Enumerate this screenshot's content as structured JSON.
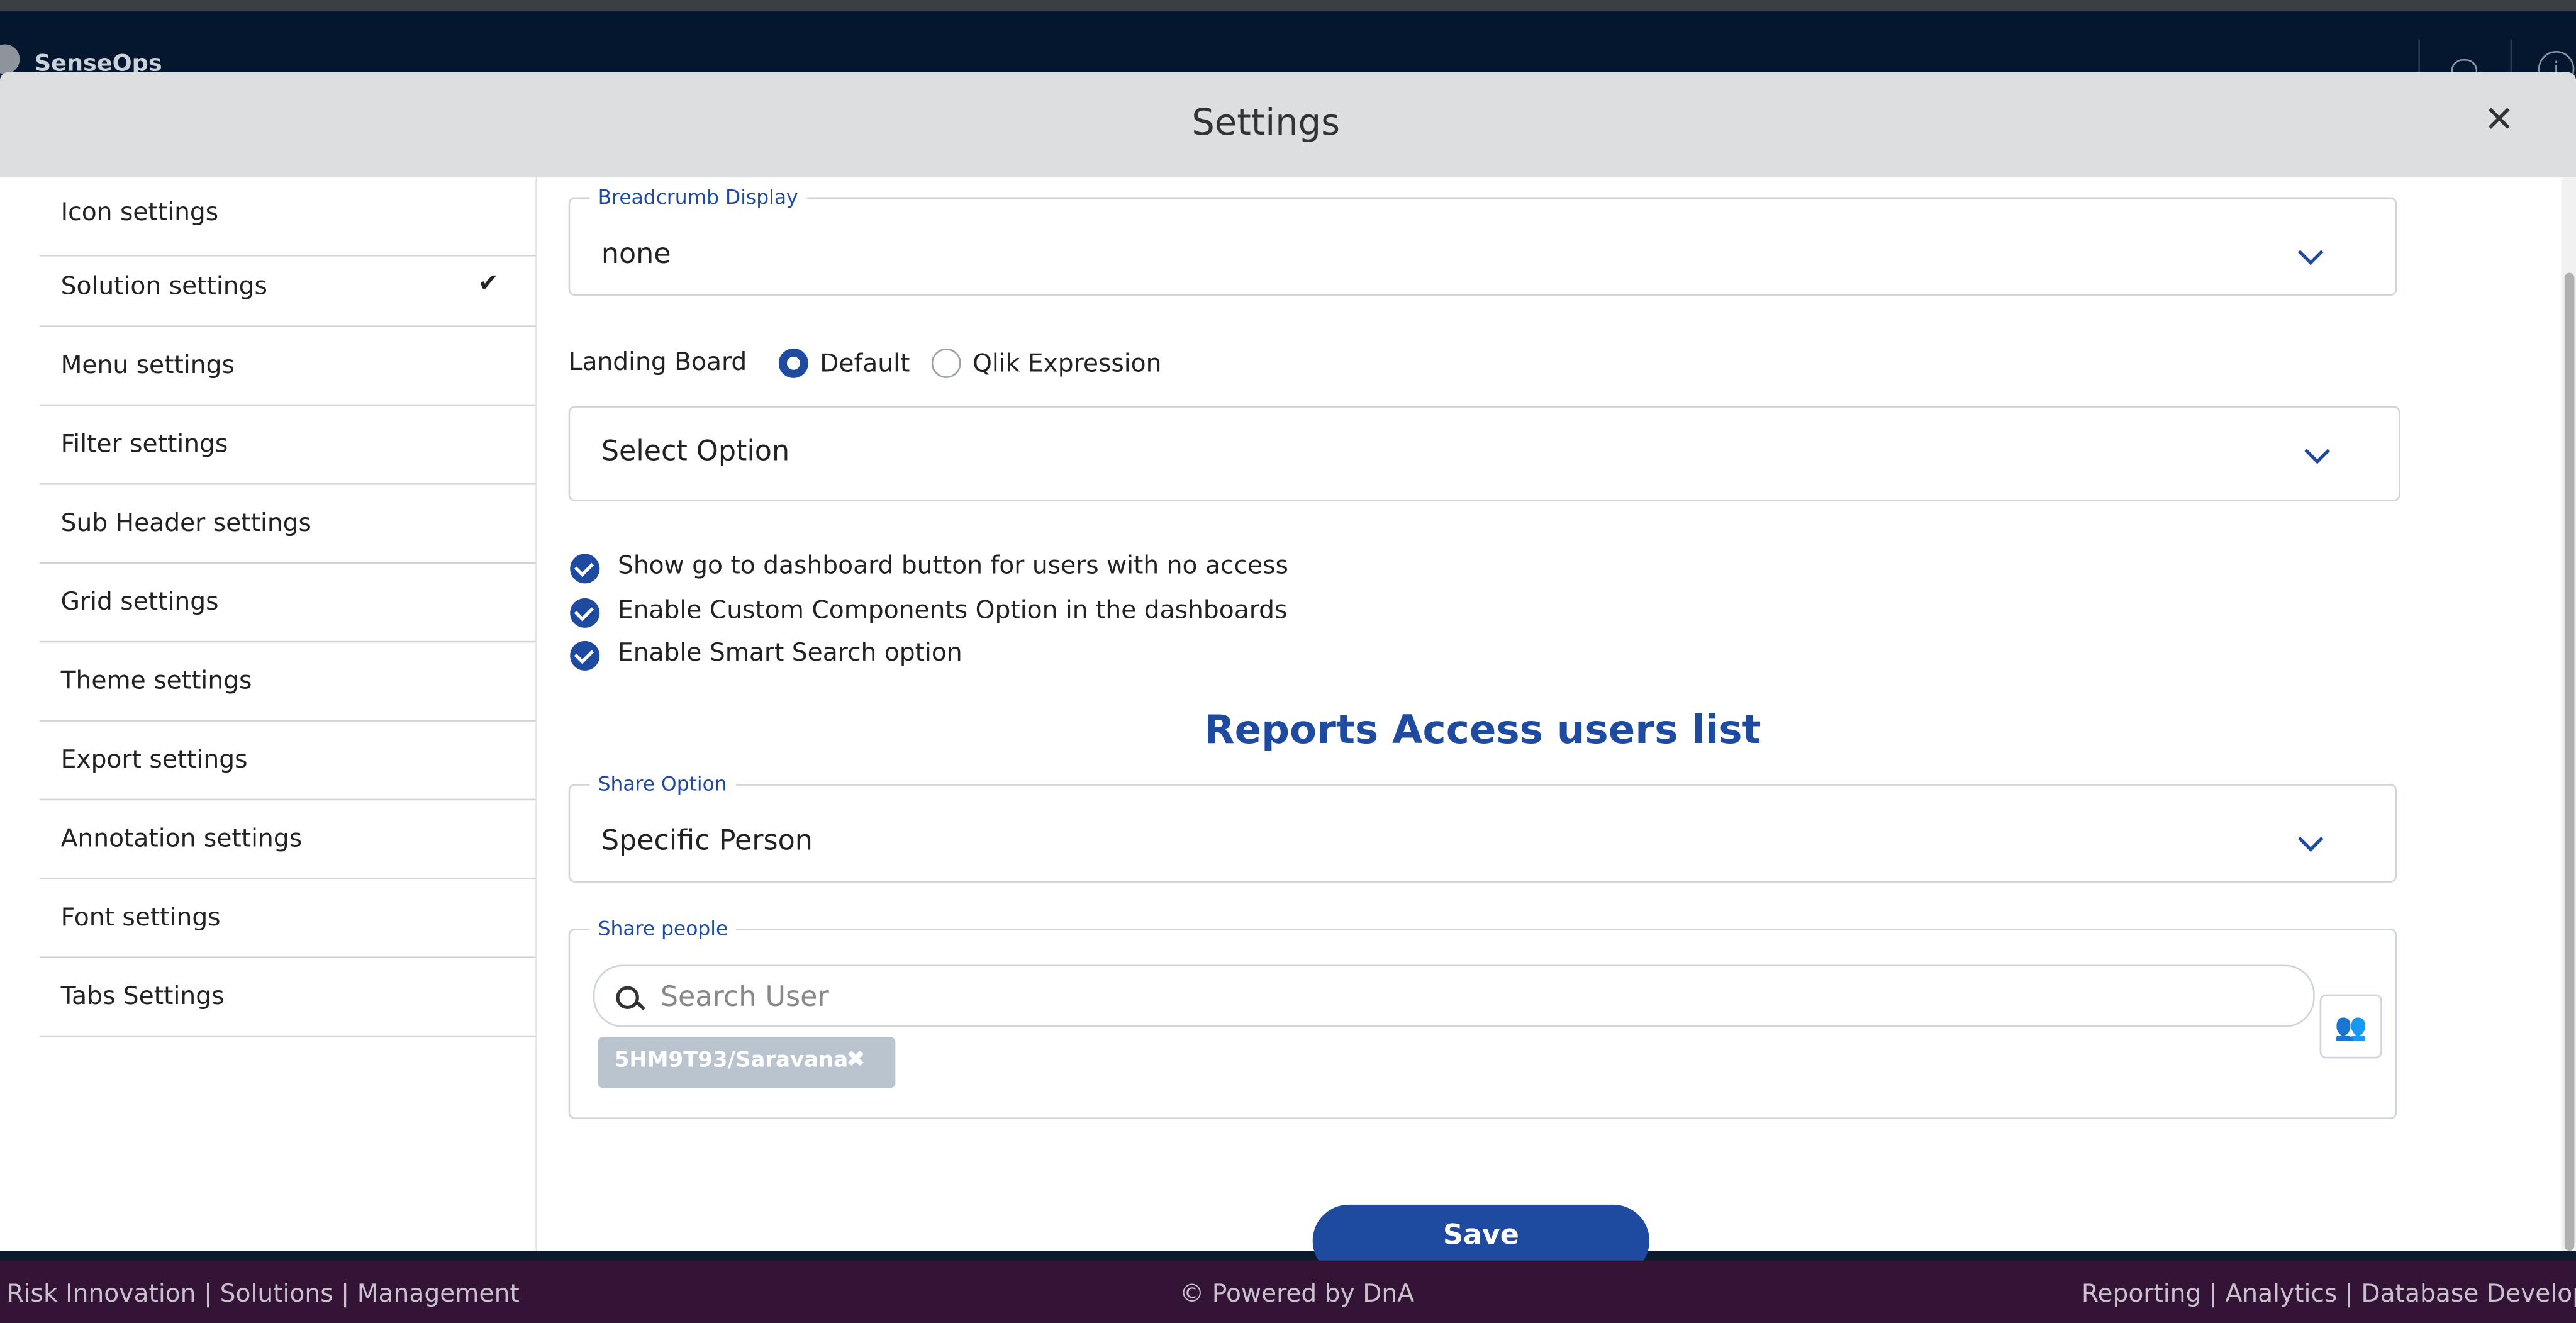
{
  "app": {
    "title": "SenseOps"
  },
  "modal": {
    "title": "Settings",
    "close_label": "✕"
  },
  "sidebar": {
    "items": [
      {
        "label": "Icon settings"
      },
      {
        "label": "Solution settings",
        "selected": true
      },
      {
        "label": "Menu settings"
      },
      {
        "label": "Filter settings"
      },
      {
        "label": "Sub Header settings"
      },
      {
        "label": "Grid settings"
      },
      {
        "label": "Theme settings"
      },
      {
        "label": "Export settings"
      },
      {
        "label": "Annotation settings"
      },
      {
        "label": "Font settings"
      },
      {
        "label": "Tabs Settings"
      }
    ],
    "check_mark": "✔"
  },
  "breadcrumb_display": {
    "label": "Breadcrumb Display",
    "value": "none"
  },
  "landing_board": {
    "label": "Landing Board",
    "options": [
      "Default",
      "Qlik Expression"
    ],
    "selected": "Default",
    "select_placeholder": "Select Option"
  },
  "checkboxes": [
    {
      "label": "Show go to dashboard button for users with no access",
      "checked": true
    },
    {
      "label": "Enable Custom Components Option in the dashboards",
      "checked": true
    },
    {
      "label": "Enable Smart Search option",
      "checked": true
    }
  ],
  "reports_access": {
    "title": "Reports Access users list",
    "share_option": {
      "label": "Share Option",
      "value": "Specific Person"
    },
    "share_people": {
      "label": "Share people",
      "search_placeholder": "Search User",
      "chips": [
        {
          "label": "5HM9T93/Saravana"
        }
      ],
      "group_icon": "users-icon"
    }
  },
  "save_label": "Save",
  "footer": {
    "left": "Risk Innovation | Solutions | Management",
    "center": "© Powered by DnA",
    "right": "Reporting | Analytics | Database Develop"
  },
  "colors": {
    "accent": "#1e4ba0",
    "app_bar": "#04172f",
    "modal_header": "#dcdee0",
    "footer": "#331436",
    "chip": "#b9c4cf"
  }
}
